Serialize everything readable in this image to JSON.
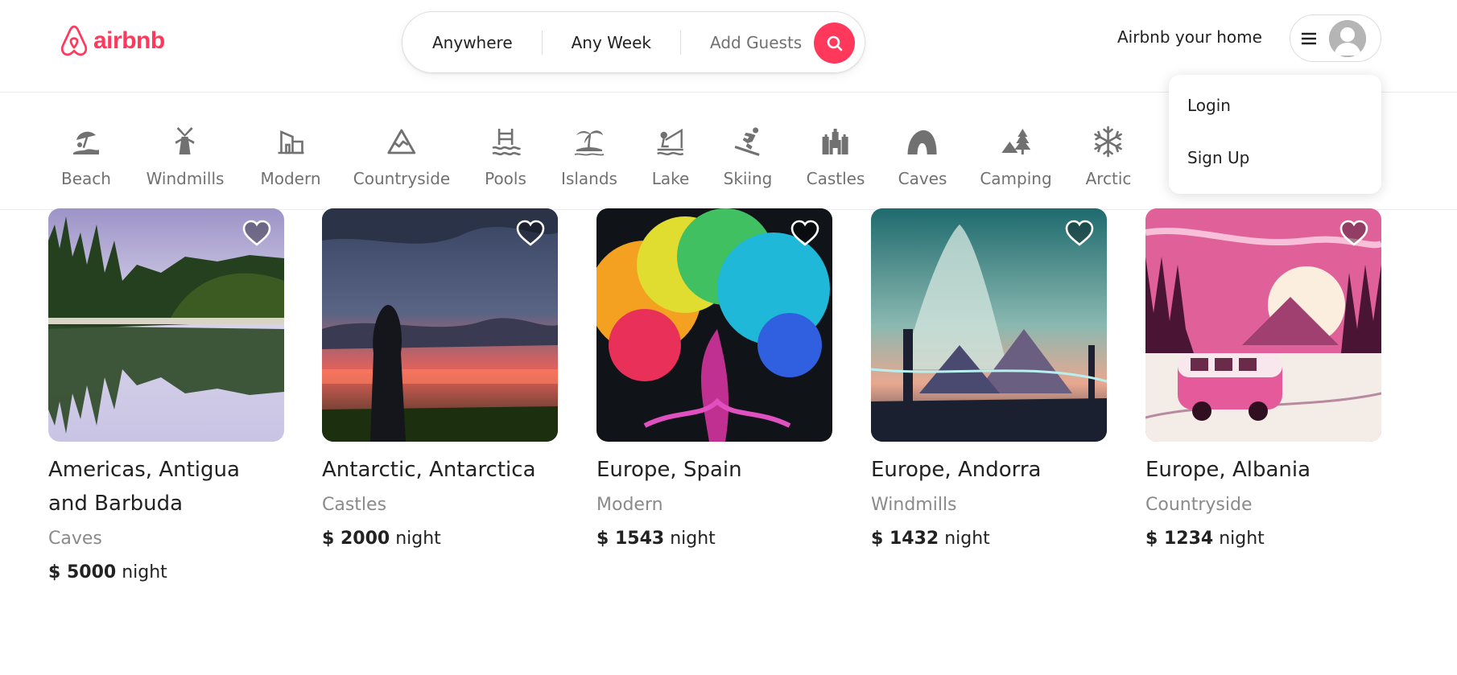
{
  "brand": {
    "name": "airbnb",
    "color": "#ff385c",
    "icon": "airbnb-logo-icon"
  },
  "search": {
    "location": "Anywhere",
    "dates": "Any Week",
    "guests": "Add Guests",
    "icon": "search-icon"
  },
  "header": {
    "host_link": "Airbnb your home",
    "menu_icon": "hamburger-menu-icon",
    "avatar_icon": "user-avatar-icon"
  },
  "dropdown": {
    "items": [
      {
        "label": "Login"
      },
      {
        "label": "Sign Up"
      }
    ]
  },
  "categories": [
    {
      "label": "Beach",
      "icon": "beach-umbrella-icon"
    },
    {
      "label": "Windmills",
      "icon": "windmill-icon"
    },
    {
      "label": "Modern",
      "icon": "modern-house-icon"
    },
    {
      "label": "Countryside",
      "icon": "mountain-icon"
    },
    {
      "label": "Pools",
      "icon": "pool-icon"
    },
    {
      "label": "Islands",
      "icon": "island-palm-icon"
    },
    {
      "label": "Lake",
      "icon": "lake-fishing-icon"
    },
    {
      "label": "Skiing",
      "icon": "skiing-icon"
    },
    {
      "label": "Castles",
      "icon": "castle-icon"
    },
    {
      "label": "Caves",
      "icon": "cave-icon"
    },
    {
      "label": "Camping",
      "icon": "camping-tent-icon"
    },
    {
      "label": "Arctic",
      "icon": "snowflake-icon"
    }
  ],
  "listings": [
    {
      "title": "Americas, Antigua and Barbuda",
      "category": "Caves",
      "price": "$ 5000",
      "unit": "night",
      "image": "forest-lake-reflection-image"
    },
    {
      "title": "Antarctic, Antarctica",
      "category": "Castles",
      "price": "$ 2000",
      "unit": "night",
      "image": "sunset-silhouette-image"
    },
    {
      "title": "Europe, Spain",
      "category": "Modern",
      "price": "$ 1543",
      "unit": "night",
      "image": "rainbow-tree-image"
    },
    {
      "title": "Europe, Andorra",
      "category": "Windmills",
      "price": "$ 1432",
      "unit": "night",
      "image": "fantasy-mountains-image"
    },
    {
      "title": "Europe, Albania",
      "category": "Countryside",
      "price": "$ 1234",
      "unit": "night",
      "image": "pink-van-forest-image"
    }
  ],
  "heart_icon": "heart-outline-icon"
}
